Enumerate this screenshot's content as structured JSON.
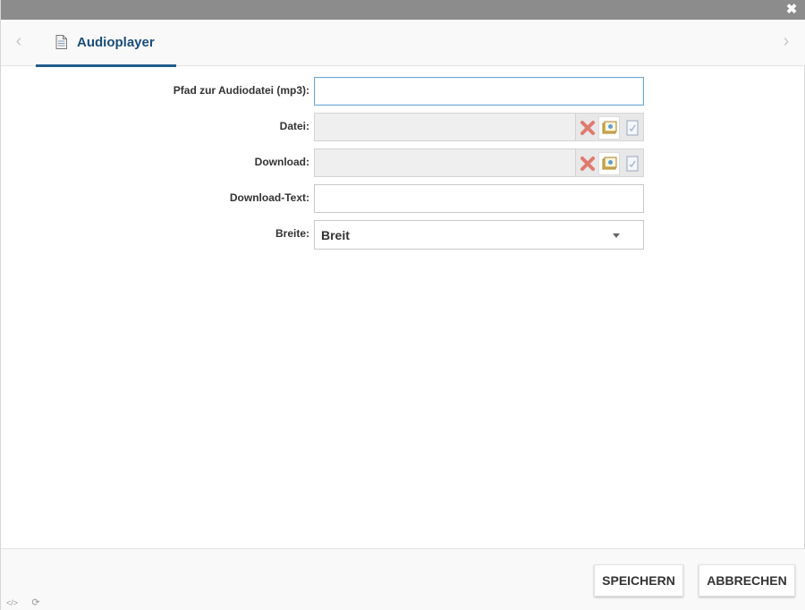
{
  "dialog": {
    "close_glyph": "✖",
    "nav_prev_glyph": "‹",
    "nav_next_glyph": "›"
  },
  "tab": {
    "label": "Audioplayer",
    "icon": "document-icon"
  },
  "form": {
    "audio_path": {
      "label": "Pfad zur Audiodatei (mp3):",
      "value": ""
    },
    "file": {
      "label": "Datei:",
      "value": ""
    },
    "download": {
      "label": "Download:",
      "value": ""
    },
    "download_text": {
      "label": "Download-Text:",
      "value": ""
    },
    "width": {
      "label": "Breite:",
      "selected": "Breit"
    }
  },
  "footer": {
    "save_label": "SPEICHERN",
    "cancel_label": "ABBRECHEN",
    "source_glyph": "</>",
    "refresh_glyph": "⟳"
  },
  "colors": {
    "titlebar": "#8c8c8c",
    "accent": "#1f5d8c",
    "tab_text": "#1a4d7a",
    "focus_border": "#6ea8d8"
  }
}
